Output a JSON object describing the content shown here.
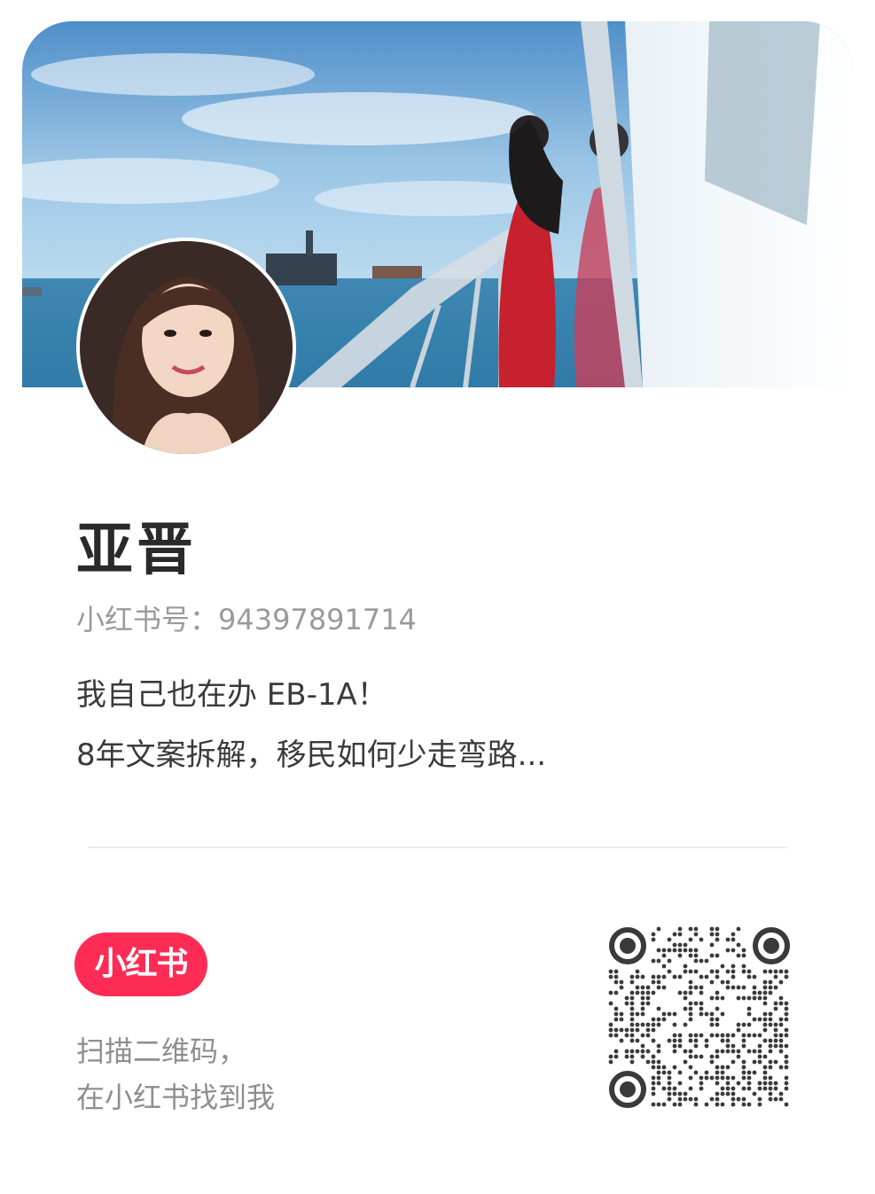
{
  "profile": {
    "name": "亚晋",
    "account_label": "小红书号：",
    "account_id": "94397891714",
    "bio_lines": [
      "我自己也在办 EB-1A！",
      "8年文案拆解，移民如何少走弯路..."
    ]
  },
  "footer": {
    "brand_logo": "小红书",
    "scan_line1": "扫描二维码，",
    "scan_line2": "在小红书找到我"
  },
  "icons": {
    "qr": "qr-code-icon",
    "brand": "xiaohongshu-logo-icon"
  },
  "colors": {
    "brand_red": "#fe2c55",
    "name_text": "#2a2a2a",
    "muted_text": "#9a9a9a",
    "bio_text": "#3a3a3a"
  }
}
